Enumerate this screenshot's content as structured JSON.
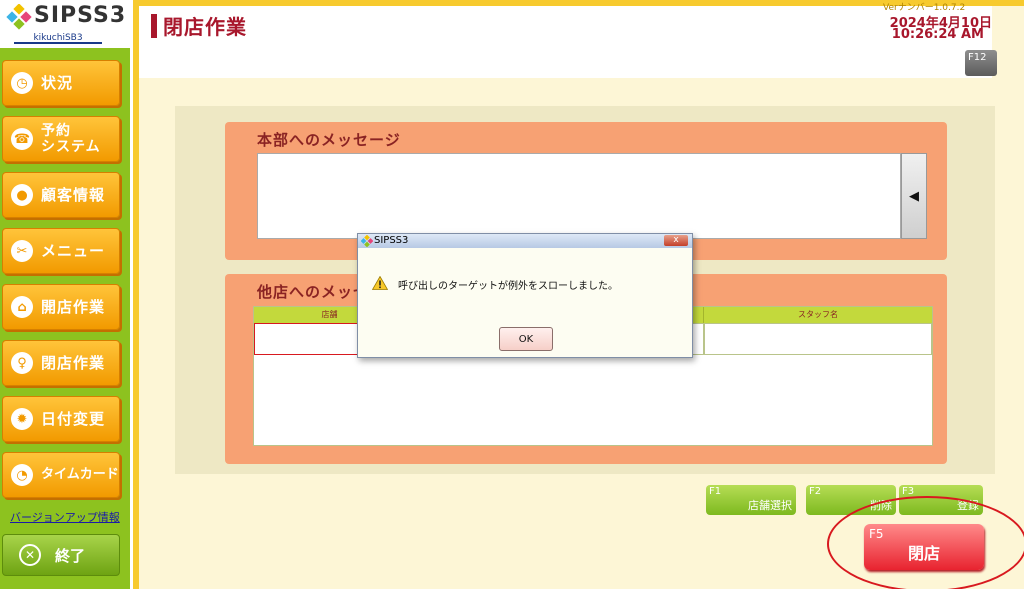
{
  "app": {
    "logo_text": "SIPSS3",
    "user_name": "kikuchiSB3"
  },
  "sidebar": {
    "items": [
      {
        "label": "状況",
        "icon": "clock-icon",
        "glyph": "◷"
      },
      {
        "label": "予約\nシステム",
        "icon": "phone-icon",
        "glyph": "☎"
      },
      {
        "label": "顧客情報",
        "icon": "person-icon",
        "glyph": "●"
      },
      {
        "label": "メニュー",
        "icon": "scissors-icon",
        "glyph": "✂"
      },
      {
        "label": "開店作業",
        "icon": "shop-icon",
        "glyph": "⌂"
      },
      {
        "label": "閉店作業",
        "icon": "key-icon",
        "glyph": "♀"
      },
      {
        "label": "日付変更",
        "icon": "gear-icon",
        "glyph": "✹"
      },
      {
        "label": "タイムカード",
        "icon": "timecard-icon",
        "glyph": "◔"
      }
    ],
    "version_link": "バージョンアップ情報",
    "exit_label": "終了",
    "exit_glyph": "✕"
  },
  "header": {
    "title": "閉店作業",
    "version": "Verナンバー1.0.7.2",
    "date": "2024年4月10日",
    "time": "10:26:24 AM",
    "f12_key": "F12"
  },
  "hq_message": {
    "label": "本部へのメッセージ",
    "value": "",
    "arrow": "◀"
  },
  "other_message": {
    "label": "他店へのメッセ",
    "columns": [
      "店舗",
      "",
      "スタッフ名"
    ]
  },
  "function_keys": [
    {
      "key": "F1",
      "label": "店舗選択"
    },
    {
      "key": "F2",
      "label": "削除"
    },
    {
      "key": "F3",
      "label": "登録"
    }
  ],
  "f5": {
    "key": "F5",
    "label": "閉店"
  },
  "dialog": {
    "title": "SIPSS3",
    "close_glyph": "x",
    "message": "呼び出しのターゲットが例外をスローしました。",
    "ok_label": "OK"
  },
  "colors": {
    "sidebar": "#8dc21f",
    "nav_button": "#f29a00",
    "title": "#a8172c",
    "message_block": "#f7a173",
    "f5_button": "#e8232f",
    "annotation_circle": "#d8191f"
  }
}
